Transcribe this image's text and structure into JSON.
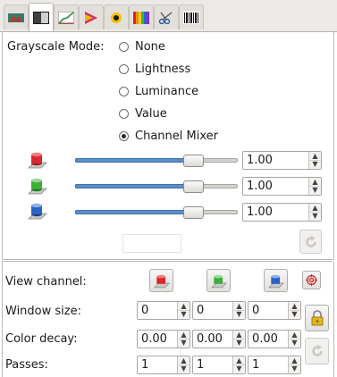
{
  "tabs": [
    {
      "icon": "transform-icon",
      "active": false
    },
    {
      "icon": "grayscale-icon",
      "active": true
    },
    {
      "icon": "curves-icon",
      "active": false
    },
    {
      "icon": "color-mixer-icon",
      "active": false
    },
    {
      "icon": "color-picker-icon",
      "active": false
    },
    {
      "icon": "spectrum-icon",
      "active": false
    },
    {
      "icon": "scissors-icon",
      "active": false
    },
    {
      "icon": "barcode-icon",
      "active": false
    }
  ],
  "grayscale": {
    "label": "Grayscale Mode:",
    "options": [
      "None",
      "Lightness",
      "Luminance",
      "Value",
      "Channel Mixer"
    ],
    "selected": "Channel Mixer"
  },
  "mixer": {
    "channels": [
      {
        "icon": "red-channel-icon",
        "color": "#d9272e",
        "value": "1.00",
        "level": 0.72
      },
      {
        "icon": "green-channel-icon",
        "color": "#3fae3a",
        "value": "1.00",
        "level": 0.72
      },
      {
        "icon": "blue-channel-icon",
        "color": "#2b62c4",
        "value": "1.00",
        "level": 0.72
      }
    ],
    "reset_icon": "reset-icon"
  },
  "lower": {
    "view_channel_label": "View channel:",
    "window_size_label": "Window size:",
    "color_decay_label": "Color decay:",
    "passes_label": "Passes:",
    "window_size": [
      "0",
      "0",
      "0"
    ],
    "color_decay": [
      "0.00",
      "0.00",
      "0.00"
    ],
    "passes": [
      "1",
      "1",
      "1"
    ],
    "lock_icon": "lock-icon",
    "reset_icon": "reset-icon"
  }
}
